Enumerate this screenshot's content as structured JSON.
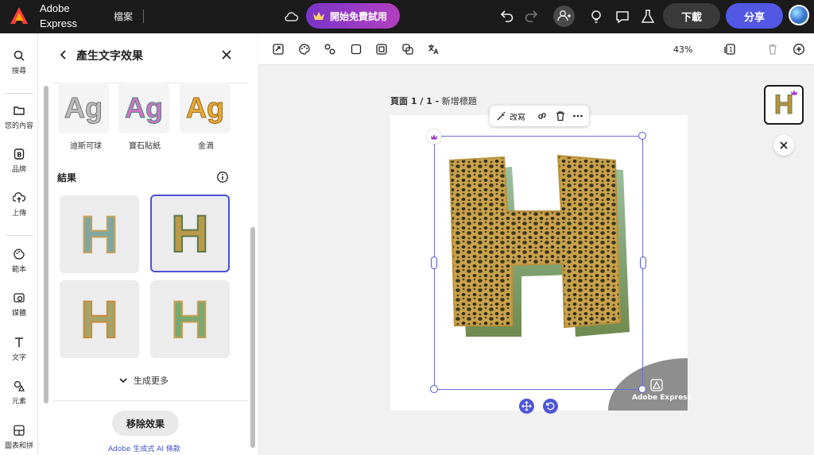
{
  "app": {
    "brand_line1": "Adobe",
    "brand_line2": "Express",
    "file_menu": "檔案"
  },
  "header": {
    "trial_label": "開始免費試用",
    "download_label": "下載",
    "share_label": "分享"
  },
  "rail": {
    "items": [
      {
        "label": "搜尋",
        "icon": "search-icon"
      },
      {
        "label": "您的內容",
        "icon": "folder-icon"
      },
      {
        "label": "品牌",
        "icon": "brand-icon"
      },
      {
        "label": "上傳",
        "icon": "upload-icon"
      },
      {
        "label": "範本",
        "icon": "template-icon"
      },
      {
        "label": "媒體",
        "icon": "media-icon"
      },
      {
        "label": "文字",
        "icon": "text-icon"
      },
      {
        "label": "元素",
        "icon": "elements-icon"
      },
      {
        "label": "圖表和拼",
        "icon": "grid-icon"
      }
    ]
  },
  "panel": {
    "title": "產生文字效果",
    "styles": [
      {
        "label": "迪斯可球",
        "sample": "Ag"
      },
      {
        "label": "寶石貼紙",
        "sample": "Ag"
      },
      {
        "label": "金滴",
        "sample": "Ag"
      }
    ],
    "results_label": "結果",
    "results": [
      {
        "glyph": "H"
      },
      {
        "glyph": "H"
      },
      {
        "glyph": "H"
      },
      {
        "glyph": "H"
      }
    ],
    "more_label": "生成更多",
    "remove_label": "移除效果",
    "terms_label": "Adobe 生成式 AI 條款"
  },
  "toolbar": {
    "zoom": "43%"
  },
  "canvas": {
    "page_label_bold": "頁面 1 / 1 -",
    "page_label_title": "新增標題",
    "context_edit_label": "改寫",
    "watermark": "Adobe Express"
  },
  "thumbnail": {
    "glyph": "H"
  },
  "colors": {
    "accent": "#5258e4",
    "trial_start": "#7a34c9",
    "trial_end": "#b33fbf",
    "selection": "#4b52d8"
  }
}
